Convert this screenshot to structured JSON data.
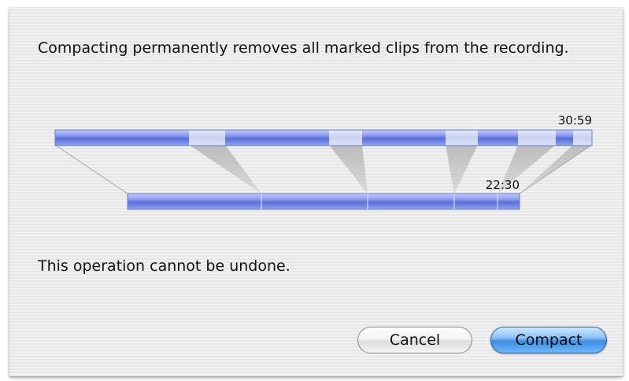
{
  "dialog": {
    "message": "Compacting permanently removes all marked clips from the recording.",
    "warning": "This operation cannot be undone."
  },
  "diagram": {
    "original_duration": "30:59",
    "compacted_duration": "22:30"
  },
  "buttons": {
    "cancel": "Cancel",
    "compact": "Compact"
  },
  "colors": {
    "segment_kept": "#6a7fe0",
    "segment_marked": "#c8d2ee",
    "default_button": "#3d8fe4"
  }
}
